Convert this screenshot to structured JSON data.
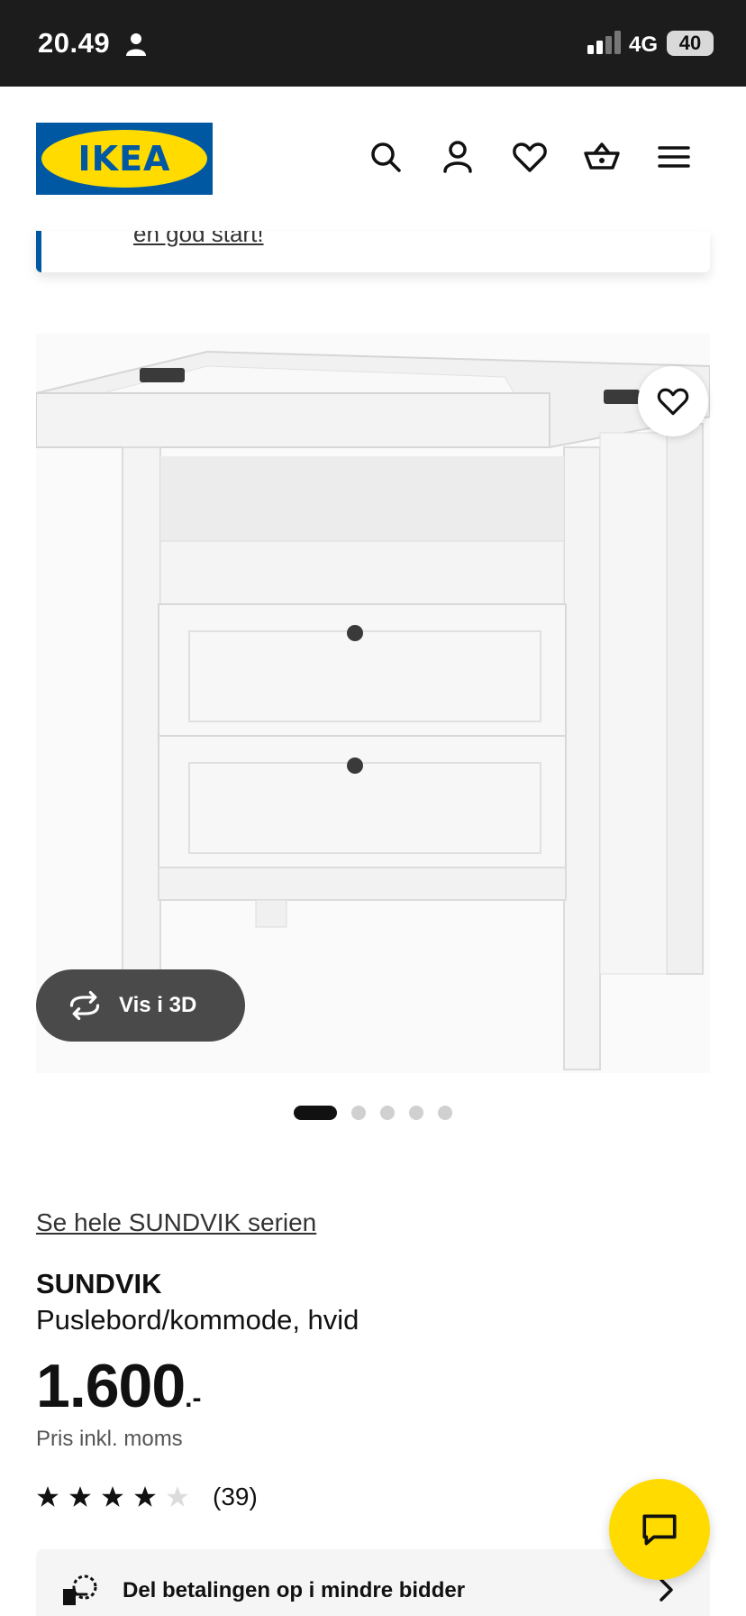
{
  "status_bar": {
    "time": "20.49",
    "network": "4G",
    "battery": "40"
  },
  "header": {
    "logo_text": "IKEA",
    "icons": [
      "search-icon",
      "account-icon",
      "favorites-icon",
      "cart-icon",
      "menu-icon"
    ]
  },
  "info_card": {
    "link_text": "en god start!"
  },
  "gallery": {
    "view_3d_label": "Vis i 3D",
    "total_images": 5,
    "active_index": 0
  },
  "product": {
    "series_link": "Se hele SUNDVIK serien",
    "name": "SUNDVIK",
    "description": "Puslebord/kommode, hvid",
    "price": "1.600",
    "price_suffix": ".-",
    "price_note": "Pris inkl. moms",
    "rating": 4,
    "rating_max": 5,
    "review_count": "(39)"
  },
  "payment_banner": {
    "text": "Del betalingen op i mindre bidder"
  },
  "colors": {
    "brand_blue": "#0058a3",
    "brand_yellow": "#ffdb00",
    "status_bar_bg": "#1c1c1c"
  }
}
